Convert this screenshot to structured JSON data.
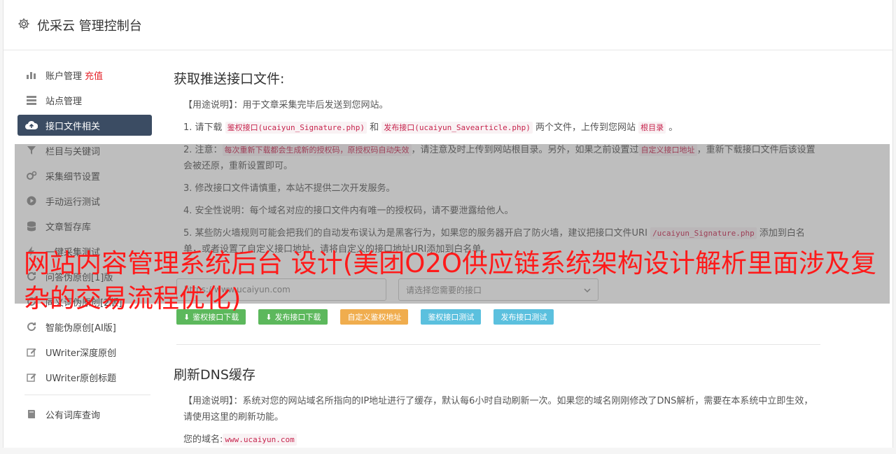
{
  "app": {
    "title": "优采云 管理控制台"
  },
  "sidebar": {
    "items": [
      {
        "label": "账户管理",
        "badge": "充值",
        "icon": "bar-chart-icon"
      },
      {
        "label": "站点管理",
        "icon": "list-icon"
      },
      {
        "label": "接口文件相关",
        "icon": "cloud-upload-icon",
        "active": true
      },
      {
        "label": "栏目与关键词",
        "icon": "filter-icon"
      },
      {
        "label": "采集细节设置",
        "icon": "gears-icon"
      },
      {
        "label": "手动运行测试",
        "icon": "play-circle-icon"
      },
      {
        "label": "文章暂存库",
        "icon": "database-icon"
      },
      {
        "label": "一键采集测试",
        "icon": "flash-icon"
      },
      {
        "label": "问答伪原创[1]版",
        "icon": "refresh-icon"
      },
      {
        "label": "同义词伪原创[2版]",
        "icon": "refresh-icon"
      },
      {
        "label": "智能伪原创[AI版]",
        "icon": "refresh-icon"
      },
      {
        "label": "UWriter深度原创",
        "icon": "edit-icon"
      },
      {
        "label": "UWriter原创标题",
        "icon": "edit-icon"
      },
      {
        "label": "公有词库查询",
        "icon": "book-icon"
      }
    ]
  },
  "section1": {
    "title": "获取推送接口文件:",
    "usage": "【用途说明】：用于文章采集完毕后发送到您网站。",
    "step1": {
      "a": "1. 请下载 ",
      "code1": "鉴权接口(ucaiyun_Signature.php)",
      "b": " 和 ",
      "code2": "发布接口(ucaiyun_Savearticle.php)",
      "c": " 两个文件，上传到您网站 ",
      "code3": "根目录",
      "d": " 。"
    },
    "step2": {
      "a": "2. 注意：",
      "code1": "每次重新下载都会生成新的授权码，原授权码自动失效",
      "b": "，请注意及时上传到网站根目录。另外，如果之前设置过",
      "code2": "自定义接口地址",
      "c": "，重新下载接口文件后该设置会被还原，重新设置即可。"
    },
    "step3": "3. 修改接口文件请慎重，本站不提供二次开发服务。",
    "step4": "4. 安全性说明：每个域名对应的接口文件内有唯一的授权码，请不要泄露给他人。",
    "step5": {
      "a": "5. 某些防火墙规则可能会把我们的自动发布误认为是黑客行为，如果您的服务器开启了防火墙，建议把接口文件URI ",
      "code1": "/ucaiyun_Signature.php",
      "b": " 添加到白名单，或者设置了自定义接口地址，请将自定义的接口地址URI添加到白名单。"
    },
    "url_value": "https://www.ucaiyun.com",
    "select_placeholder": "请选择您需要的接口",
    "buttons": {
      "download_auth": "鉴权接口下载",
      "download_publish": "发布接口下载",
      "custom_auth": "自定义鉴权地址",
      "test_auth": "鉴权接口测试",
      "test_publish": "发布接口测试"
    }
  },
  "section2": {
    "title": "刷新DNS缓存",
    "usage": "【用途说明】：系统对您的网站域名所指向的IP地址进行了缓存，默认每6小时自动刷新一次。如果您的域名刚刚修改了DNS解析，需要在本系统中立即生效，请使用这里的刷新功能。",
    "domain_label": "您的域名:",
    "domain_value": "www.ucaiyun.com"
  },
  "overlay": {
    "headline": "网站内容管理系统后台 设计(美团O2O供应链系统架构设计解析里面涉及复杂的交易流程优化)"
  },
  "colors": {
    "active_nav": "#3b4c63",
    "green": "#5cb85c",
    "orange": "#f0ad4e",
    "blue": "#5bc0de",
    "red_text": "#ff1a1a"
  }
}
